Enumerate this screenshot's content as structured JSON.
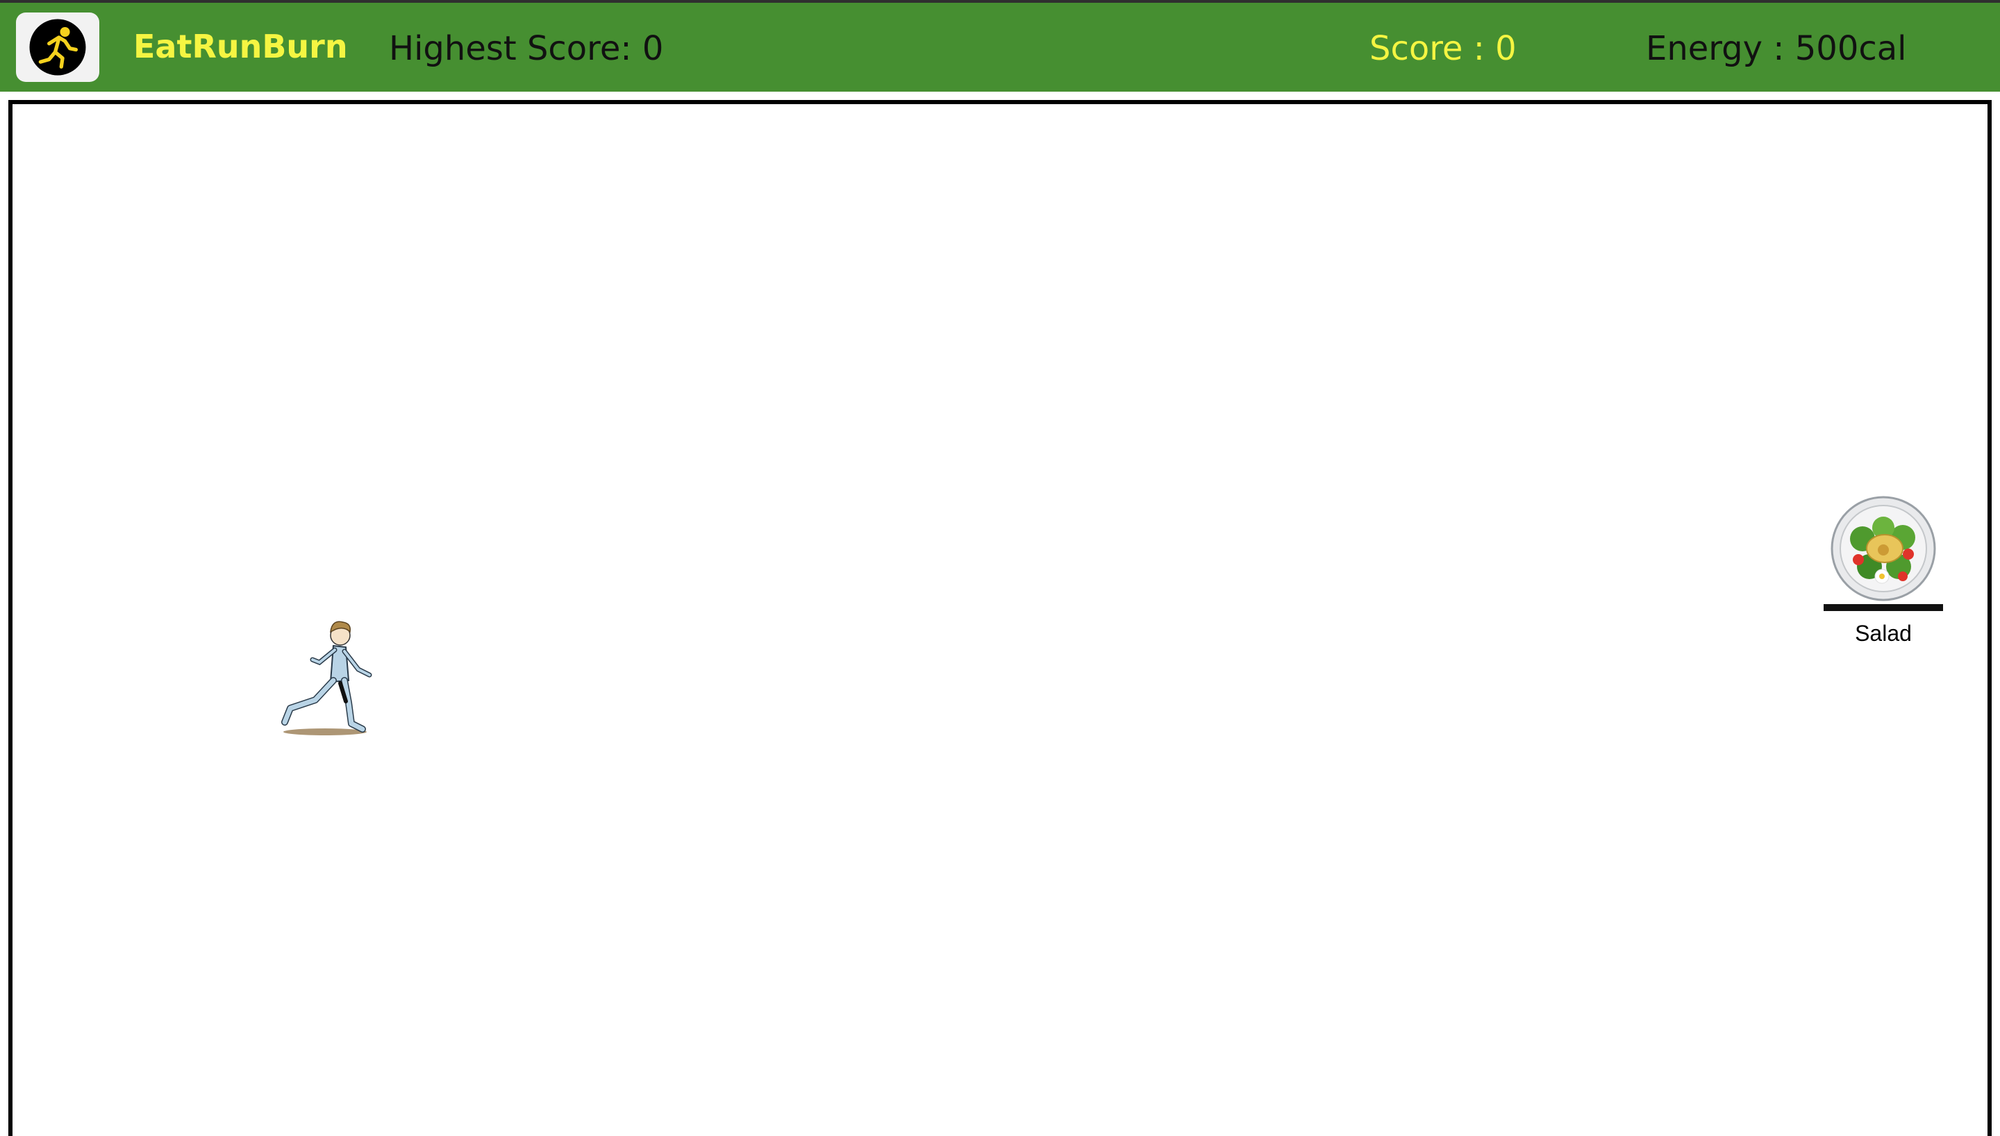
{
  "header": {
    "brand": "EatRunBurn",
    "highest_score_label": "Highest Score: ",
    "highest_score_value": "0",
    "score_label": "Score : ",
    "score_value": "0",
    "energy_label": "Energy : ",
    "energy_value": "500cal",
    "logo_icon": "running-person-icon"
  },
  "game": {
    "player_icon": "runner-sprite",
    "food_item": {
      "label": "Salad",
      "icon": "salad-plate-icon"
    }
  },
  "colors": {
    "header_bg": "#468f31",
    "accent_yellow": "#f5f542",
    "text_dark": "#111111",
    "border": "#000000"
  }
}
